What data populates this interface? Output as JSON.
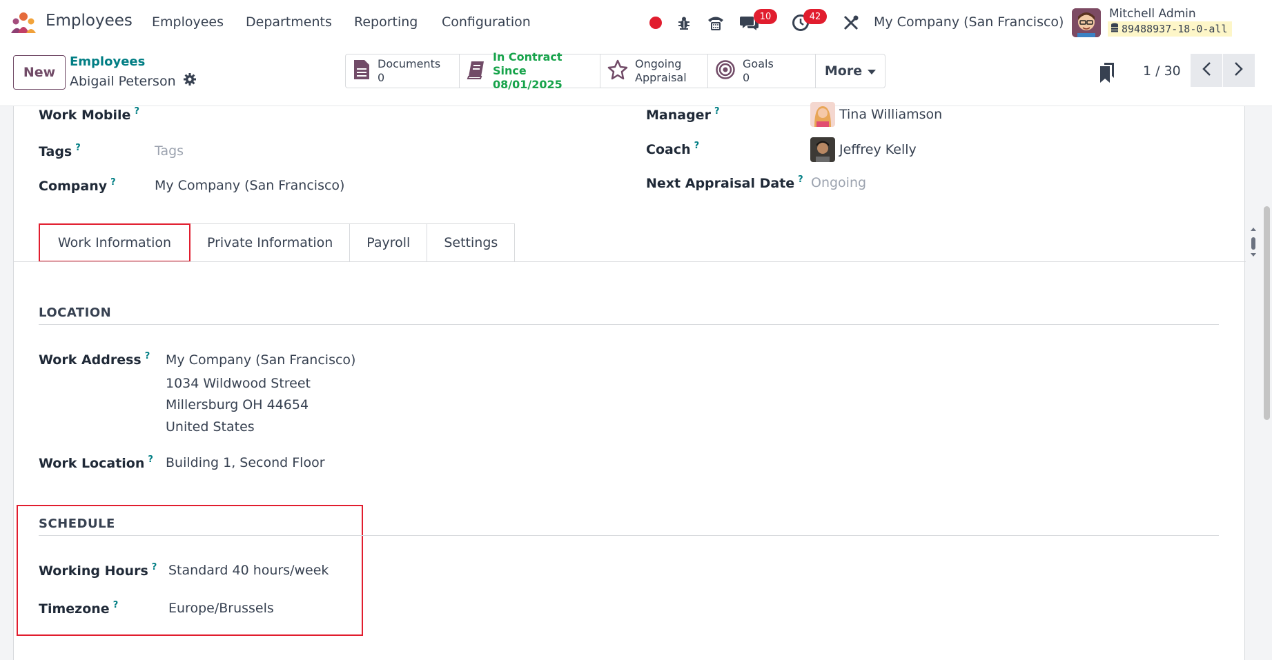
{
  "topbar": {
    "app_name": "Employees",
    "menu": [
      "Employees",
      "Departments",
      "Reporting",
      "Configuration"
    ],
    "chat_badge": "10",
    "activity_badge": "42",
    "company": "My Company (San Francisco)",
    "user_name": "Mitchell Admin",
    "db_name": "89488937-18-0-all"
  },
  "control": {
    "new_label": "New",
    "breadcrumb_parent": "Employees",
    "breadcrumb_current": "Abigail Peterson",
    "smart_buttons": {
      "documents_label": "Documents",
      "documents_count": "0",
      "contract_label": "In Contract Since",
      "contract_date": "08/01/2025",
      "appraisal_line1": "Ongoing",
      "appraisal_line2": "Appraisal",
      "goals_label": "Goals",
      "goals_count": "0",
      "more_label": "More"
    },
    "pager_value": "1 / 30"
  },
  "form": {
    "work_mobile_label": "Work Mobile",
    "tags_label": "Tags",
    "tags_placeholder": "Tags",
    "company_label": "Company",
    "company_value": "My Company (San Francisco)",
    "manager_label": "Manager",
    "manager_value": "Tina Williamson",
    "coach_label": "Coach",
    "coach_value": "Jeffrey Kelly",
    "appraisal_label": "Next Appraisal Date",
    "appraisal_value": "Ongoing"
  },
  "tabs": [
    "Work Information",
    "Private Information",
    "Payroll",
    "Settings"
  ],
  "location": {
    "title": "LOCATION",
    "work_address_label": "Work Address",
    "address_lines": [
      "My Company (San Francisco)",
      "1034 Wildwood Street",
      "Millersburg OH 44654",
      "United States"
    ],
    "work_location_label": "Work Location",
    "work_location_value": "Building 1, Second Floor"
  },
  "schedule": {
    "title": "SCHEDULE",
    "working_hours_label": "Working Hours",
    "working_hours_value": "Standard 40 hours/week",
    "timezone_label": "Timezone",
    "timezone_value": "Europe/Brussels"
  },
  "help_mark": "?",
  "colors": {
    "brand": "#714b67",
    "link": "#017e84",
    "highlight": "#e11d2e",
    "success": "#16a34a"
  }
}
